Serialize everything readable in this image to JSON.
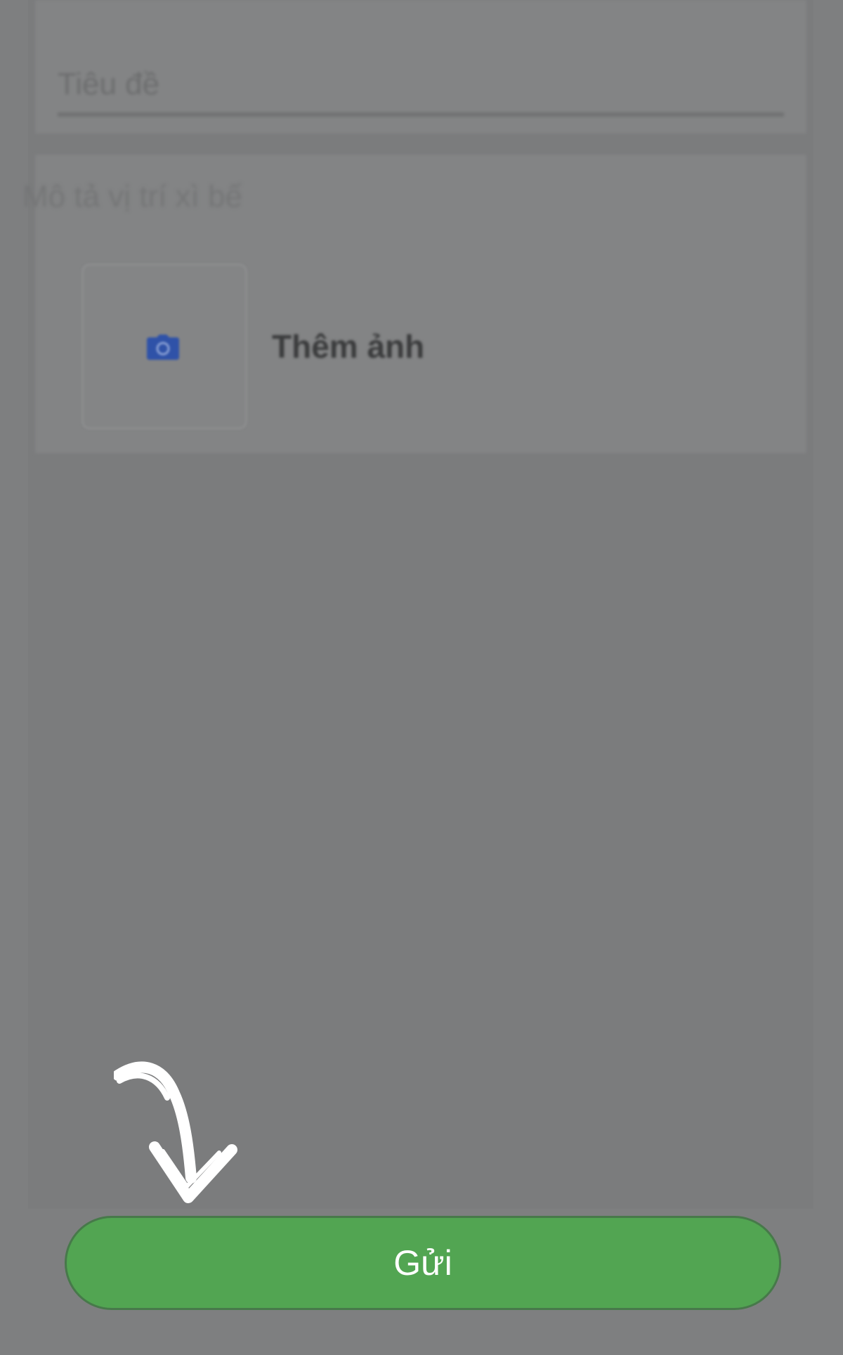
{
  "form": {
    "title_placeholder": "Tiêu đề",
    "description_placeholder": "Mô tả vị trí xì bế",
    "add_photo_label": "Thêm ảnh"
  },
  "footer": {
    "submit_label": "Gửi"
  },
  "icons": {
    "camera": "camera-icon",
    "arrow": "hand-drawn-arrow-icon"
  },
  "colors": {
    "submit_button": "#52a552",
    "camera_icon": "#2f52a8",
    "overlay_background": "#7e7f80"
  }
}
